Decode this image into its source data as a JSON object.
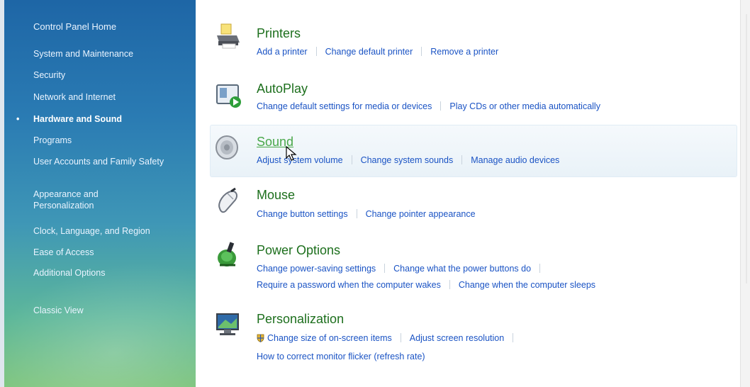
{
  "sidebar": {
    "home": "Control Panel Home",
    "items": [
      {
        "label": "System and Maintenance"
      },
      {
        "label": "Security"
      },
      {
        "label": "Network and Internet"
      },
      {
        "label": "Hardware and Sound",
        "selected": true
      },
      {
        "label": "Programs"
      },
      {
        "label": "User Accounts and Family Safety"
      },
      {
        "label": "Appearance and Personalization"
      },
      {
        "label": "Clock, Language, and Region"
      },
      {
        "label": "Ease of Access"
      },
      {
        "label": "Additional Options"
      }
    ],
    "classic_view": "Classic View",
    "bullet": "•"
  },
  "categories": [
    {
      "title": "Printers",
      "icon": "printer-icon",
      "links": [
        "Add a printer",
        "Change default printer",
        "Remove a printer"
      ]
    },
    {
      "title": "AutoPlay",
      "icon": "autoplay-icon",
      "links": [
        "Change default settings for media or devices",
        "Play CDs or other media automatically"
      ]
    },
    {
      "title": "Sound",
      "icon": "speaker-icon",
      "links": [
        "Adjust system volume",
        "Change system sounds",
        "Manage audio devices"
      ]
    },
    {
      "title": "Mouse",
      "icon": "mouse-icon",
      "links": [
        "Change button settings",
        "Change pointer appearance"
      ]
    },
    {
      "title": "Power Options",
      "icon": "power-options-icon",
      "links": [
        "Change power-saving settings",
        "Change what the power buttons do"
      ],
      "links2": [
        "Require a password when the computer wakes",
        "Change when the computer sleeps"
      ]
    },
    {
      "title": "Personalization",
      "icon": "personalization-icon",
      "links": [
        "Change size of on-screen items",
        "Adjust screen resolution"
      ],
      "links2": [
        "How to correct monitor flicker (refresh rate)"
      ]
    }
  ],
  "colors": {
    "category_title": "#1d6f1d",
    "link": "#1a53c4",
    "sidebar_top": "#1e66a6",
    "sidebar_bottom": "#7cc47c"
  }
}
